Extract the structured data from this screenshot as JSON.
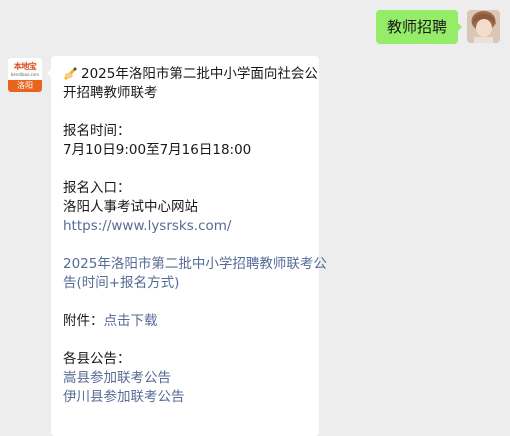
{
  "user_message": {
    "text": "教师招聘"
  },
  "bot_avatar": {
    "brand": "本地宝",
    "subtitle": "bendibao.com",
    "city": "洛阳"
  },
  "reply": {
    "emoji": "writing-hand",
    "title_line1": "2025年洛阳市第二批中小学面向社会公",
    "title_line2": "开招聘教师联考",
    "reg_time_label": "报名时间：",
    "reg_time_value": "7月10日9:00至7月16日18:00",
    "entry_label": "报名入口：",
    "entry_site": "洛阳人事考试中心网站",
    "entry_url": "https://www.lysrsks.com/",
    "notice_link_line1": "2025年洛阳市第二批中小学招聘教师联考公",
    "notice_link_line2": "告(时间+报名方式)",
    "attachment_label": "附件：",
    "attachment_link": "点击下载",
    "county_label": "各县公告：",
    "county_links": [
      "嵩县参加联考公告",
      "伊川县参加联考公告"
    ]
  },
  "colors": {
    "user_bubble": "#95ec69",
    "link": "#576b95",
    "background": "#ededed"
  }
}
